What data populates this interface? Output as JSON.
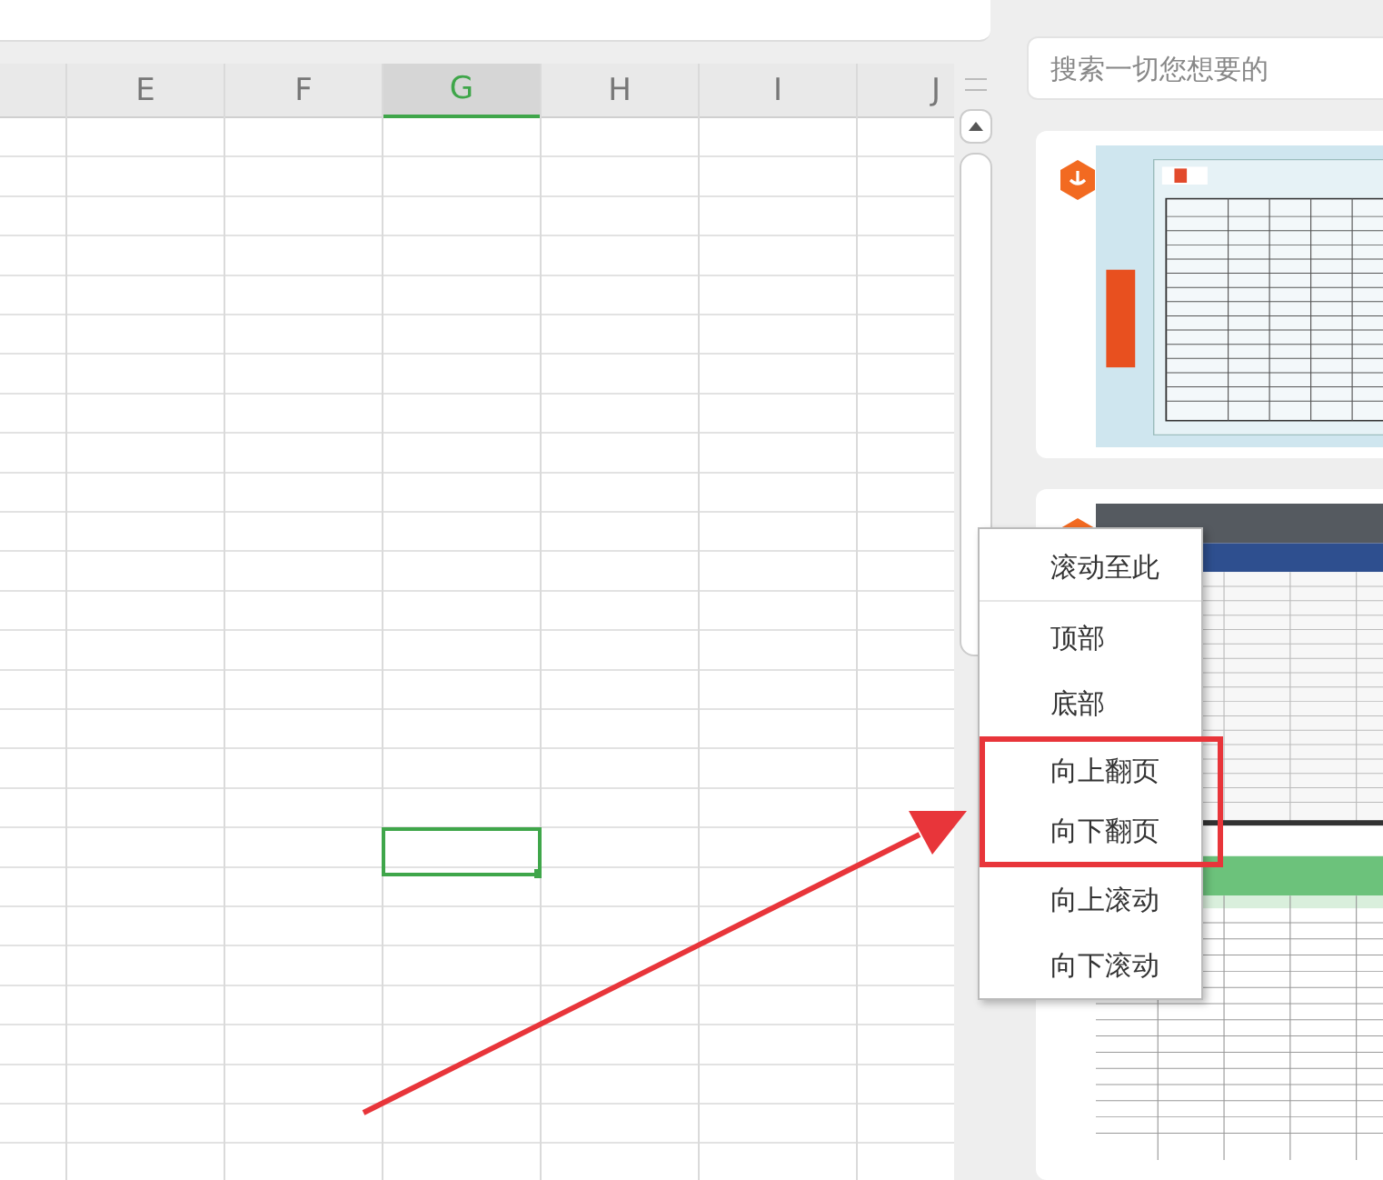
{
  "columns": [
    {
      "selected": false
    },
    {
      "label": "E",
      "selected": false
    },
    {
      "label": "F",
      "selected": false
    },
    {
      "label": "G",
      "selected": true
    },
    {
      "label": "H",
      "selected": false
    },
    {
      "label": "I",
      "selected": false
    },
    {
      "label": "J",
      "selected": false
    }
  ],
  "search": {
    "placeholder": "搜索一切您想要的"
  },
  "context_menu": [
    {
      "label": "滚动至此",
      "divider_after": true,
      "highlighted": false
    },
    {
      "label": "顶部",
      "divider_after": false,
      "highlighted": false
    },
    {
      "label": "底部",
      "divider_after": false,
      "highlighted": false
    },
    {
      "label": "向上翻页",
      "divider_after": false,
      "highlighted": true
    },
    {
      "label": "向下翻页",
      "divider_after": false,
      "highlighted": true
    },
    {
      "label": "向上滚动",
      "divider_after": false,
      "highlighted": false
    },
    {
      "label": "向下滚动",
      "divider_after": false,
      "highlighted": false
    }
  ]
}
